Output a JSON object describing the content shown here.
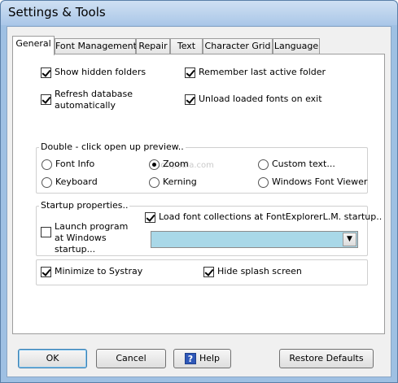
{
  "window": {
    "title": "Settings & Tools"
  },
  "tabs": [
    {
      "label": "General",
      "active": true
    },
    {
      "label": "Font Management",
      "active": false
    },
    {
      "label": "Repair",
      "active": false
    },
    {
      "label": "Text",
      "active": false
    },
    {
      "label": "Character Grid",
      "active": false
    },
    {
      "label": "Language",
      "active": false
    }
  ],
  "general": {
    "show_hidden_folders": {
      "label": "Show hidden folders",
      "checked": true
    },
    "remember_last_folder": {
      "label": "Remember last active folder",
      "checked": true
    },
    "refresh_database": {
      "label": "Refresh database automatically",
      "checked": true
    },
    "unload_fonts": {
      "label": "Unload loaded fonts on exit",
      "checked": true
    }
  },
  "preview_group": {
    "label": "Double - click open up preview..",
    "options": [
      {
        "label": "Font Info",
        "selected": false
      },
      {
        "label": "Zoom",
        "selected": true
      },
      {
        "label": "Custom text...",
        "selected": false
      },
      {
        "label": "Keyboard",
        "selected": false
      },
      {
        "label": "Kerning",
        "selected": false
      },
      {
        "label": "Windows Font Viewer",
        "selected": false
      }
    ]
  },
  "startup_group": {
    "label": "Startup properties..",
    "launch_program": {
      "label": "Launch program at Windows startup...",
      "checked": false
    },
    "load_collections": {
      "label": "Load font collections at FontExplorerL.M. startup..",
      "checked": true
    },
    "collection_select": {
      "value": ""
    }
  },
  "minimize_systray": {
    "label": "Minimize to Systray",
    "checked": true
  },
  "hide_splash": {
    "label": "Hide splash screen",
    "checked": true
  },
  "buttons": {
    "ok": "OK",
    "cancel": "Cancel",
    "help": "Help",
    "restore": "Restore Defaults"
  },
  "watermark": "softpedia.com"
}
